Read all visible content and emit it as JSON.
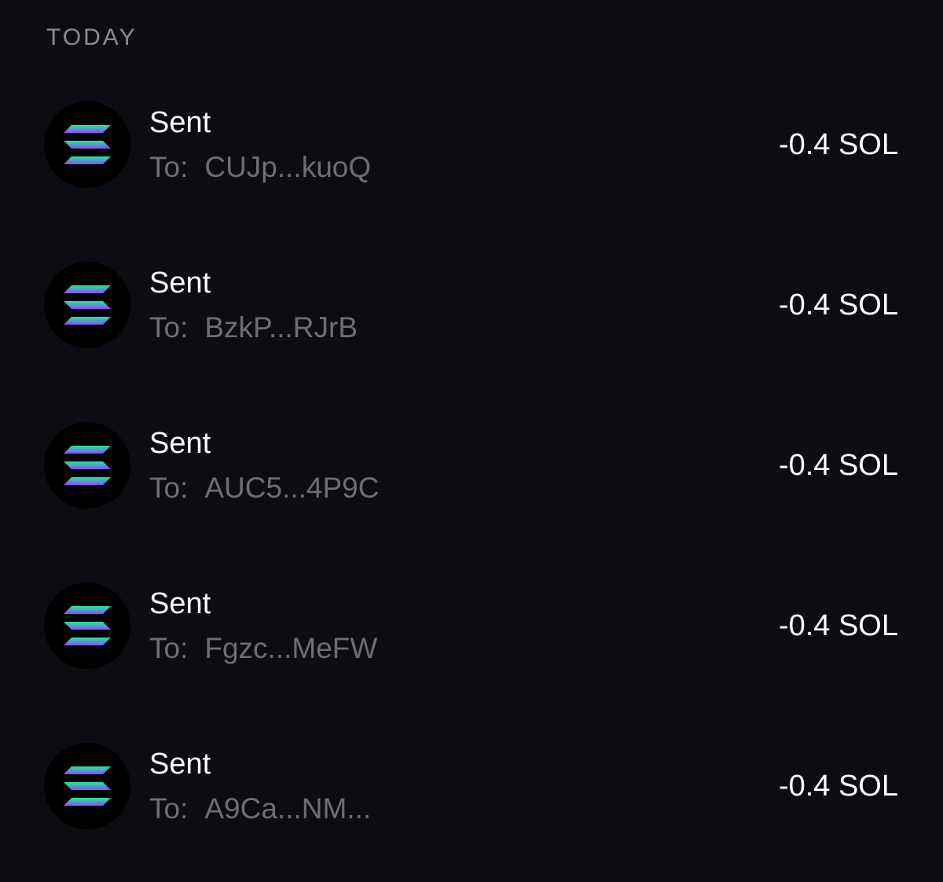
{
  "section": {
    "title": "TODAY"
  },
  "token_icon": "solana-logo-icon",
  "colors": {
    "background": "#0b0d12",
    "primary_text": "#ffffff",
    "secondary_text": "#6d6e73",
    "solana_gradient_start": "#14f195",
    "solana_gradient_end": "#9945ff"
  },
  "transactions": [
    {
      "title": "Sent",
      "to_label": "To:",
      "address": "CUJp...kuoQ",
      "amount": "-0.4 SOL"
    },
    {
      "title": "Sent",
      "to_label": "To:",
      "address": "BzkP...RJrB",
      "amount": "-0.4 SOL"
    },
    {
      "title": "Sent",
      "to_label": "To:",
      "address": "AUC5...4P9C",
      "amount": "-0.4 SOL"
    },
    {
      "title": "Sent",
      "to_label": "To:",
      "address": "Fgzc...MeFW",
      "amount": "-0.4 SOL"
    },
    {
      "title": "Sent",
      "to_label": "To:",
      "address": "A9Ca...NM...",
      "amount": "-0.4 SOL"
    }
  ]
}
